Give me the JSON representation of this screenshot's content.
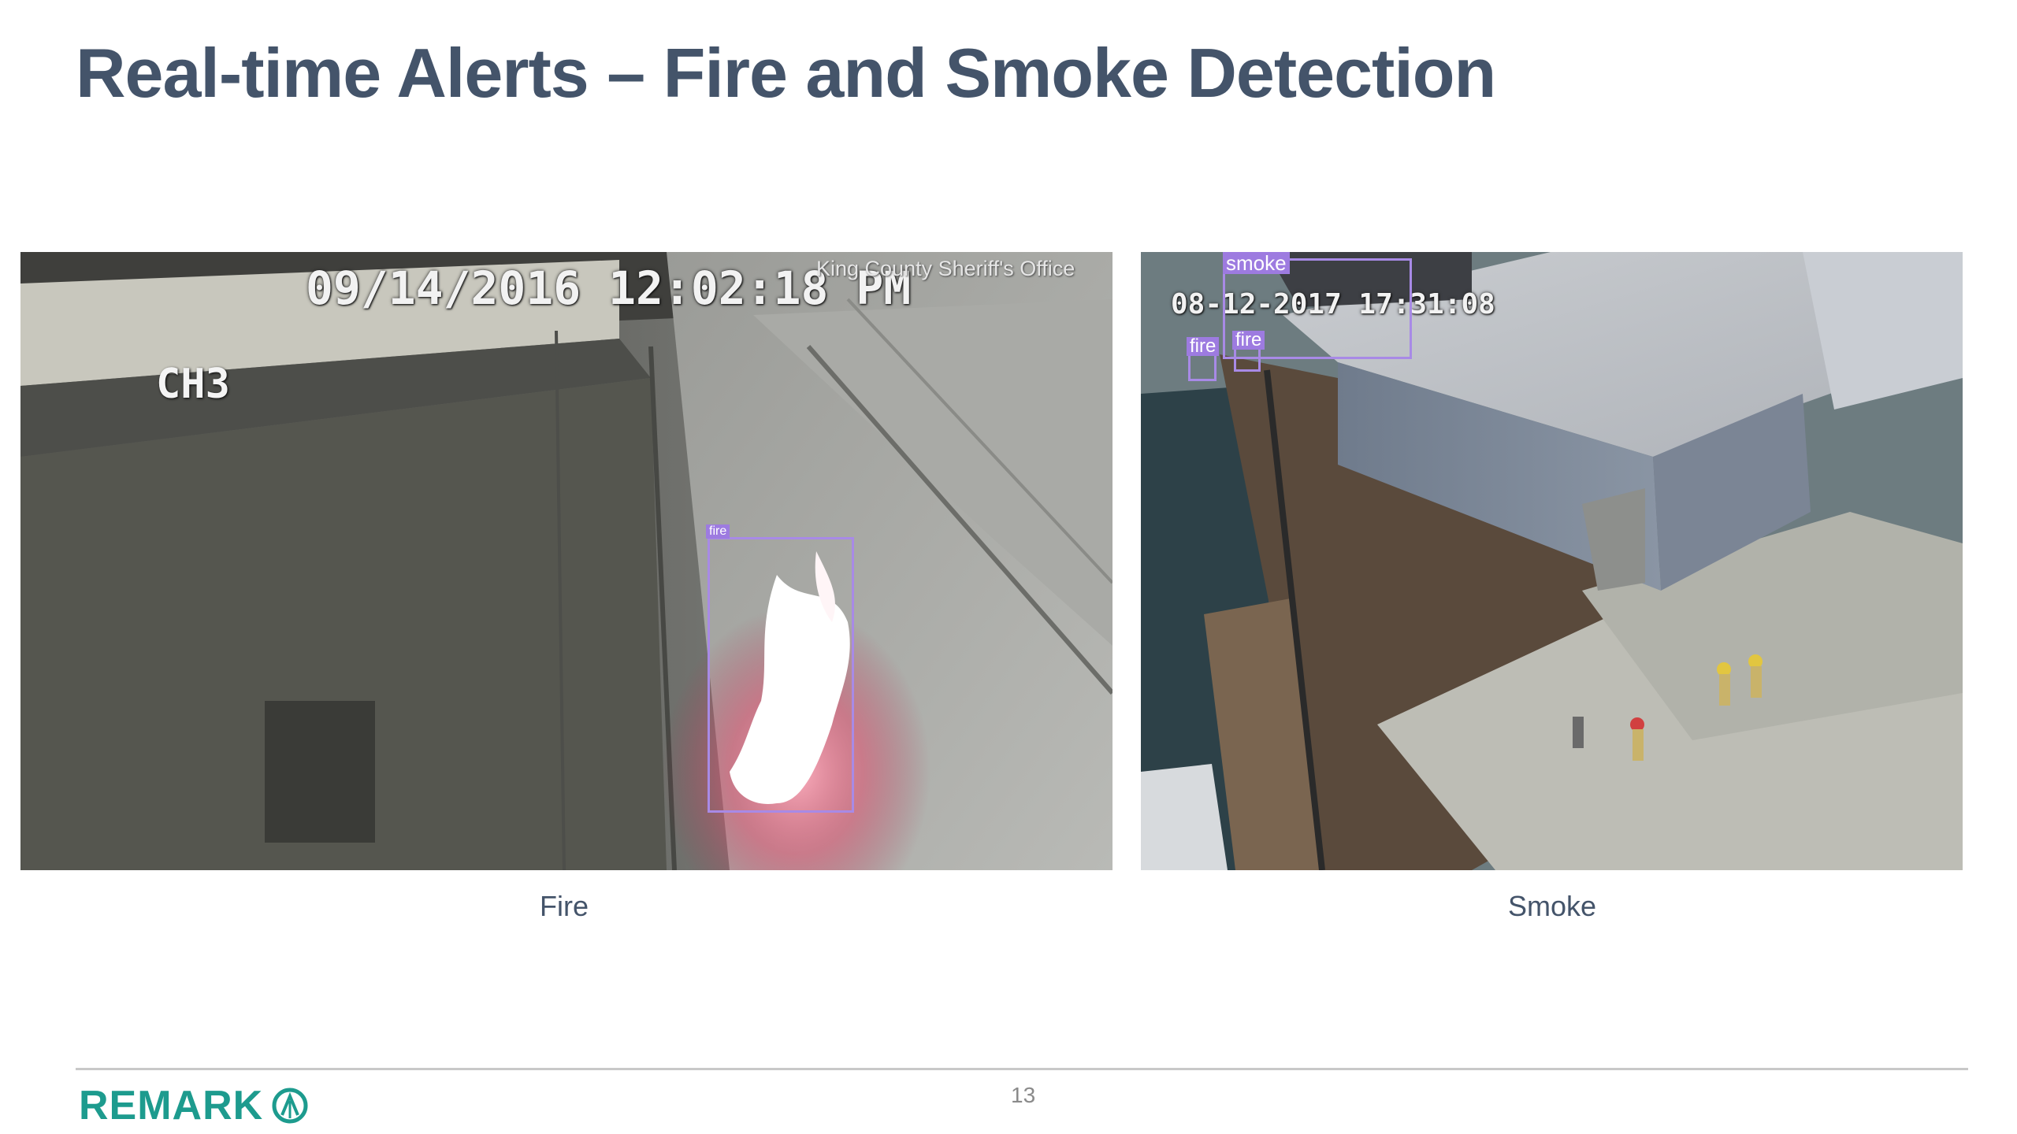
{
  "slide": {
    "title": "Real-time Alerts – Fire and Smoke Detection",
    "page_number": "13"
  },
  "fire_panel": {
    "timestamp": "09/14/2016 12:02:18 PM",
    "channel": "CH3",
    "source": "King County Sheriff's Office",
    "detections": [
      "fire"
    ],
    "caption": "Fire"
  },
  "smoke_panel": {
    "timestamp": "08-12-2017 17:31:08",
    "detections": [
      "smoke",
      "fire",
      "fire"
    ],
    "caption": "Smoke"
  },
  "footer": {
    "logo_text": "REMARK",
    "logo_icon": "remark-logo-icon"
  },
  "colors": {
    "title": "#44546a",
    "caption": "#44546a",
    "brand": "#1d9b8e",
    "detection_box": "#a88ae6"
  }
}
